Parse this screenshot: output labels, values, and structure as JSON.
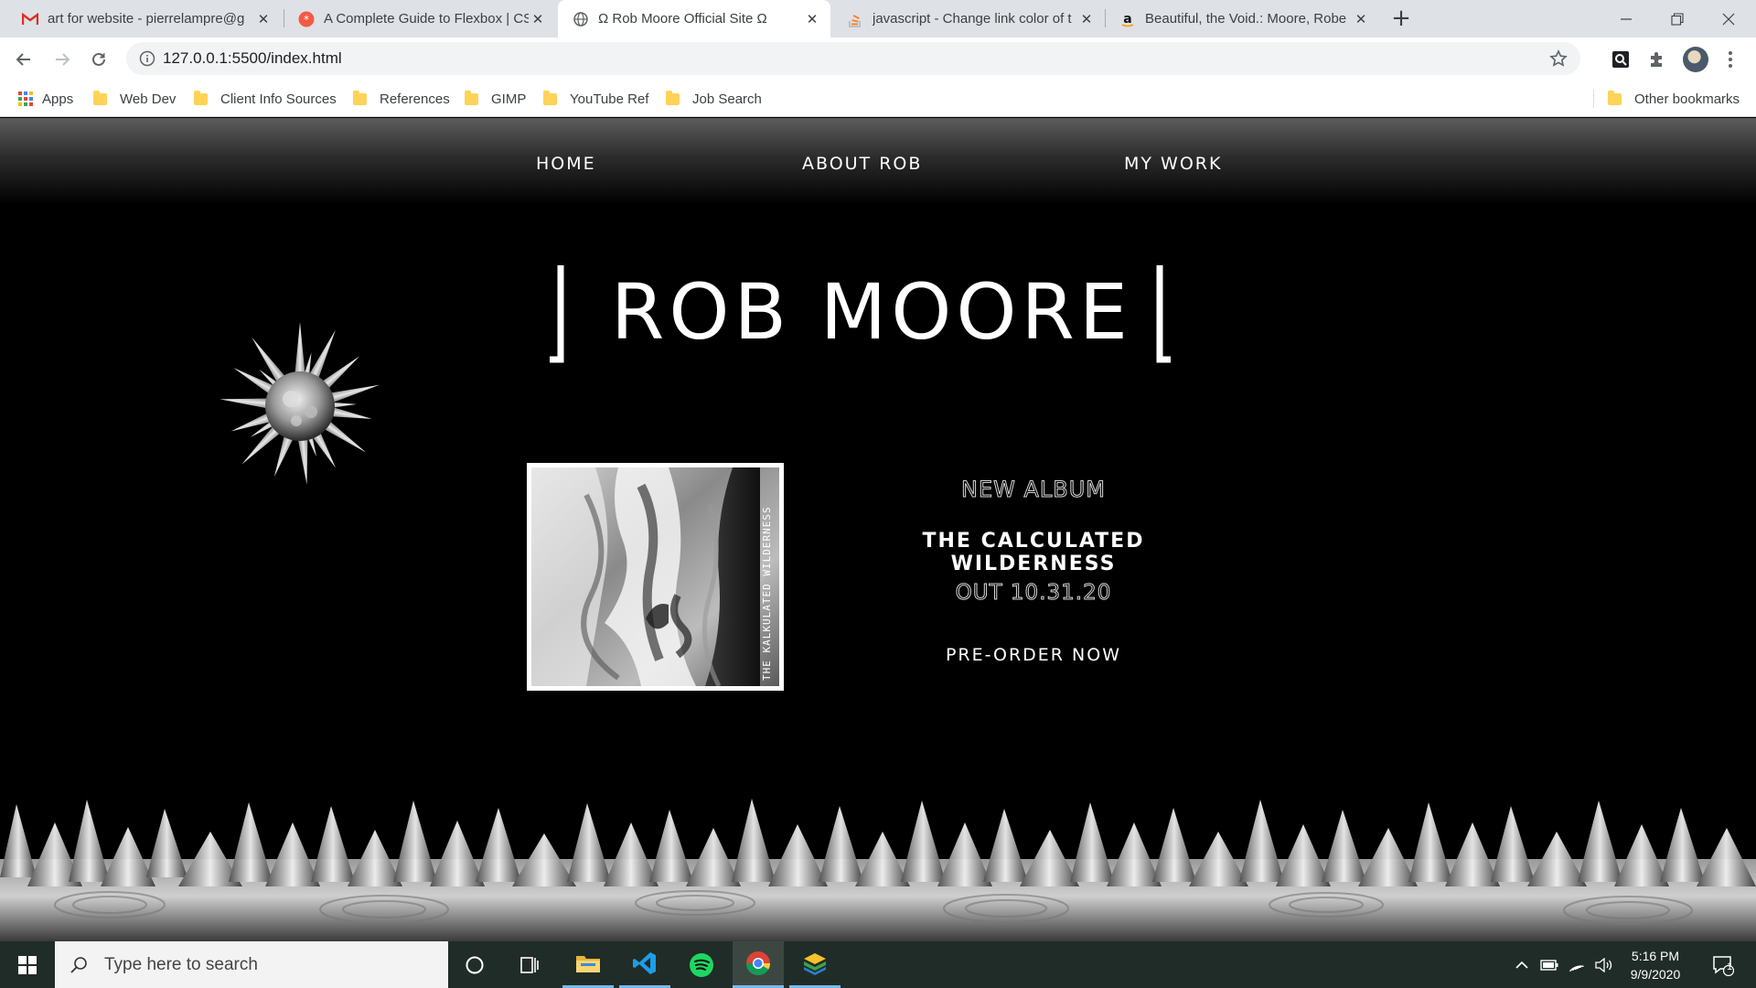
{
  "browser": {
    "tabs": [
      {
        "title": "art for website - pierrelampre@g",
        "icon": "gmail-icon"
      },
      {
        "title": "A Complete Guide to Flexbox | CS",
        "icon": "css-tricks-icon"
      },
      {
        "title": "Ω Rob Moore Official Site Ω",
        "icon": "globe-icon",
        "active": true
      },
      {
        "title": "javascript - Change link color of t",
        "icon": "stackoverflow-icon"
      },
      {
        "title": "Beautiful, the Void.: Moore, Robe",
        "icon": "amazon-icon"
      }
    ],
    "url": "127.0.0.1:5500/index.html",
    "bookmarks": [
      {
        "label": "Apps",
        "icon": "apps-grid-icon"
      },
      {
        "label": "Web Dev"
      },
      {
        "label": "Client Info Sources"
      },
      {
        "label": "References"
      },
      {
        "label": "GIMP"
      },
      {
        "label": "YouTube Ref"
      },
      {
        "label": "Job Search"
      }
    ],
    "other_bookmarks": "Other bookmarks"
  },
  "site": {
    "nav": [
      "HOME",
      "ABOUT ROB",
      "MY WORK"
    ],
    "title": "ROB MOORE",
    "album_cover_text": "THE KALKULATED WILDERNESS",
    "new_album_label": "NEW ALBUM",
    "album_name": "THE CALCULATED WILDERNESS",
    "release": "OUT 10.31.20",
    "cta": "PRE-ORDER NOW"
  },
  "taskbar": {
    "search_placeholder": "Type here to search",
    "time": "5:16 PM",
    "date": "9/9/2020",
    "notification_count": "1"
  },
  "colors": {
    "page_bg": "#000000",
    "text": "#ffffff",
    "tabbar": "#dee1e6",
    "taskbar": "#202c27",
    "accent": "#76b9ed"
  }
}
